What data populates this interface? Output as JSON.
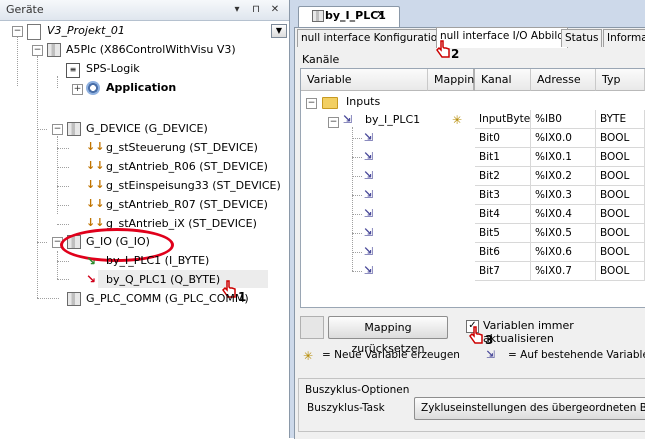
{
  "left_panel": {
    "title": "Geräte",
    "header_buttons": [
      "▾",
      "⊓",
      "✕"
    ],
    "tree": {
      "project": "V3_Projekt_01",
      "plc": "A5Plc (X86ControlWithVisu V3)",
      "logic": "SPS-Logik",
      "application": "Application",
      "device_group": "G_DEVICE (G_DEVICE)",
      "devices": [
        "g_stSteuerung (ST_DEVICE)",
        "g_stAntrieb_R06 (ST_DEVICE)",
        "g_stEinspeisung33 (ST_DEVICE)",
        "g_stAntrieb_R07 (ST_DEVICE)",
        "g_stAntrieb_iX (ST_DEVICE)"
      ],
      "io_group": "G_IO (G_IO)",
      "io_items": [
        "by_I_PLC1 (I_BYTE)",
        "by_Q_PLC1 (Q_BYTE)"
      ],
      "comm_group": "G_PLC_COMM (G_PLC_COMM)"
    },
    "step1": "1"
  },
  "editor": {
    "doc_tab": "by_I_PLC1",
    "sub_tabs": [
      "null interface Konfiguration",
      "null interface I/O Abbild",
      "Status",
      "Informa"
    ],
    "step2": "2",
    "section": "Kanäle",
    "columns": [
      "Variable",
      "Mappin",
      "Kanal",
      "Adresse",
      "Typ"
    ],
    "group_row": "Inputs",
    "main_variable": "by_I_PLC1",
    "rows": [
      {
        "kanal": "InputByte",
        "adresse": "%IB0",
        "typ": "BYTE"
      },
      {
        "kanal": "Bit0",
        "adresse": "%IX0.0",
        "typ": "BOOL"
      },
      {
        "kanal": "Bit1",
        "adresse": "%IX0.1",
        "typ": "BOOL"
      },
      {
        "kanal": "Bit2",
        "adresse": "%IX0.2",
        "typ": "BOOL"
      },
      {
        "kanal": "Bit3",
        "adresse": "%IX0.3",
        "typ": "BOOL"
      },
      {
        "kanal": "Bit4",
        "adresse": "%IX0.4",
        "typ": "BOOL"
      },
      {
        "kanal": "Bit5",
        "adresse": "%IX0.5",
        "typ": "BOOL"
      },
      {
        "kanal": "Bit6",
        "adresse": "%IX0.6",
        "typ": "BOOL"
      },
      {
        "kanal": "Bit7",
        "adresse": "%IX0.7",
        "typ": "BOOL"
      }
    ],
    "mapping_button": "Mapping zurücksetzen",
    "always_update_label": "Variablen immer aktualisieren",
    "step3": "3",
    "legend_new": "= Neue Variable erzeugen",
    "legend_existing": "= Auf bestehende Variable",
    "buszyklus_title": "Buszyklus-Optionen",
    "buszyklus_task": "Buszyklus-Task",
    "buszyklus_button": "Zykluseinstellungen des übergeordneten Busses"
  },
  "colors": {
    "accent_red": "#e0001b",
    "panel_bg": "#cdd9ea"
  }
}
